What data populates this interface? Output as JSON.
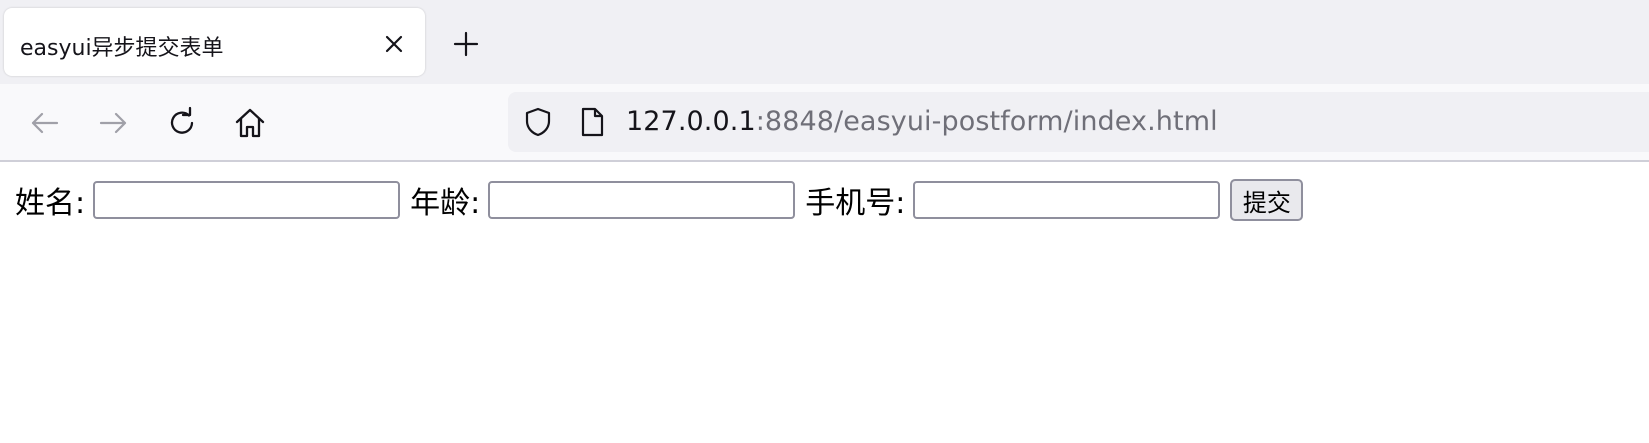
{
  "browser": {
    "tab": {
      "title": "easyui异步提交表单"
    },
    "address": {
      "host": "127.0.0.1",
      "rest": ":8848/easyui-postform/index.html"
    }
  },
  "form": {
    "fields": [
      {
        "label": "姓名:",
        "value": ""
      },
      {
        "label": "年龄:",
        "value": ""
      },
      {
        "label": "手机号:",
        "value": ""
      }
    ],
    "submit_label": "提交"
  },
  "colors": {
    "tab_strip": "#f0f0f4",
    "toolbar": "#f9f9fb",
    "input_border": "#8f8f9d",
    "button_bg": "#e9e9ed"
  }
}
